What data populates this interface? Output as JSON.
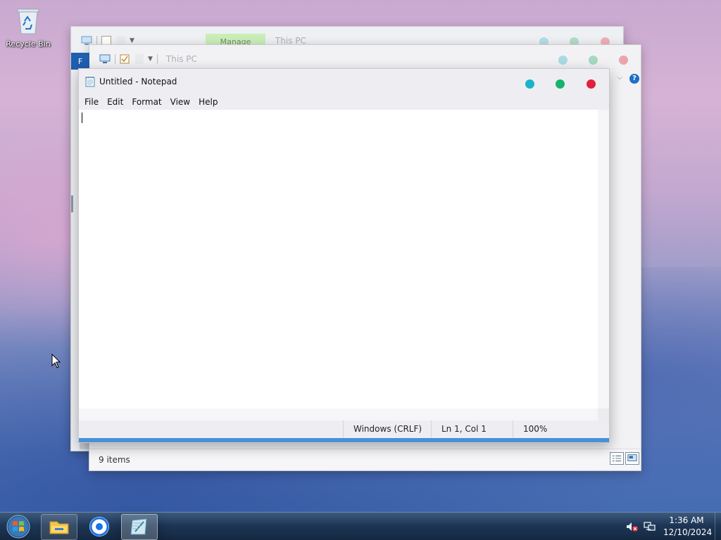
{
  "desktop": {
    "icons": [
      {
        "label": "Recycle Bin",
        "icon": "recycle-bin-icon"
      }
    ]
  },
  "explorer_back": {
    "manage_tab": "Manage",
    "title": "This PC"
  },
  "explorer_front": {
    "file_tab": "F",
    "title": "This PC",
    "status_items": "9 items",
    "help_glyph": "?"
  },
  "notepad": {
    "title": "Untitled - Notepad",
    "menu": [
      "File",
      "Edit",
      "Format",
      "View",
      "Help"
    ],
    "content": "",
    "status": {
      "line_ending": "Windows (CRLF)",
      "position": "Ln 1, Col 1",
      "zoom": "100%"
    },
    "colors": {
      "minimize": "#1ab3c8",
      "maximize": "#18b26e",
      "close": "#e0203c"
    }
  },
  "taskbar": {
    "pinned": [
      {
        "name": "File Explorer",
        "icon": "folder-icon"
      },
      {
        "name": "Google Chrome",
        "icon": "chrome-icon"
      },
      {
        "name": "Notepad",
        "icon": "notepad-icon"
      }
    ],
    "clock": {
      "time": "1:36 AM",
      "date": "12/10/2024"
    }
  }
}
